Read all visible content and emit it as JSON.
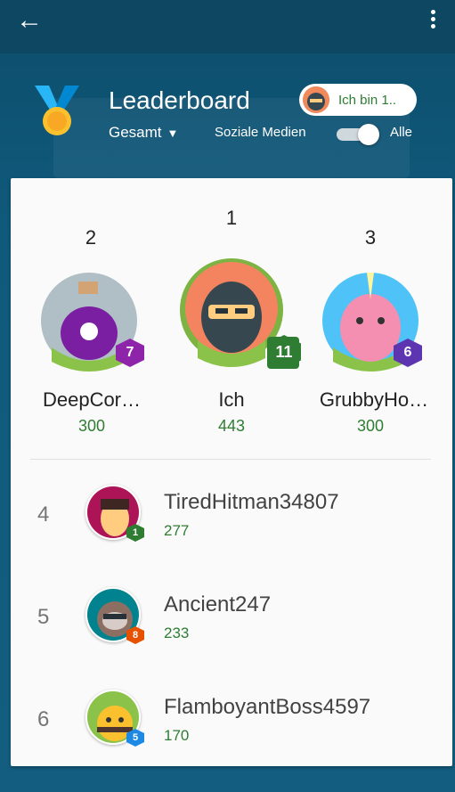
{
  "header": {
    "title": "Leaderboard",
    "filter": "Gesamt",
    "social_label": "Soziale Medien",
    "all_label": "Alle",
    "me_chip": "Ich bin 1..",
    "toggle_on": true
  },
  "podium": [
    {
      "rank": "1",
      "name": "Ich",
      "score": "443",
      "level": "11",
      "level_color": "#2e7d32",
      "avatar_icon": "ninja-avatar"
    },
    {
      "rank": "2",
      "name": "DeepCor…",
      "score": "300",
      "level": "7",
      "level_color": "#8e24aa",
      "avatar_icon": "poison-bottle-avatar"
    },
    {
      "rank": "3",
      "name": "GrubbyHo…",
      "score": "300",
      "level": "6",
      "level_color": "#5e35b1",
      "avatar_icon": "narwhal-avatar"
    }
  ],
  "list": [
    {
      "rank": "4",
      "name": "TiredHitman34807",
      "score": "277",
      "level": "1",
      "level_color": "#2e7d32",
      "avatar_icon": "samurai-avatar"
    },
    {
      "rank": "5",
      "name": "Ancient247",
      "score": "233",
      "level": "8",
      "level_color": "#e65100",
      "avatar_icon": "sloth-avatar"
    },
    {
      "rank": "6",
      "name": "FlamboyantBoss4597",
      "score": "170",
      "level": "5",
      "level_color": "#1e88e5",
      "avatar_icon": "bee-avatar"
    }
  ],
  "colors": {
    "accent": "#2e7d32",
    "header_bg": "#0d4762"
  }
}
